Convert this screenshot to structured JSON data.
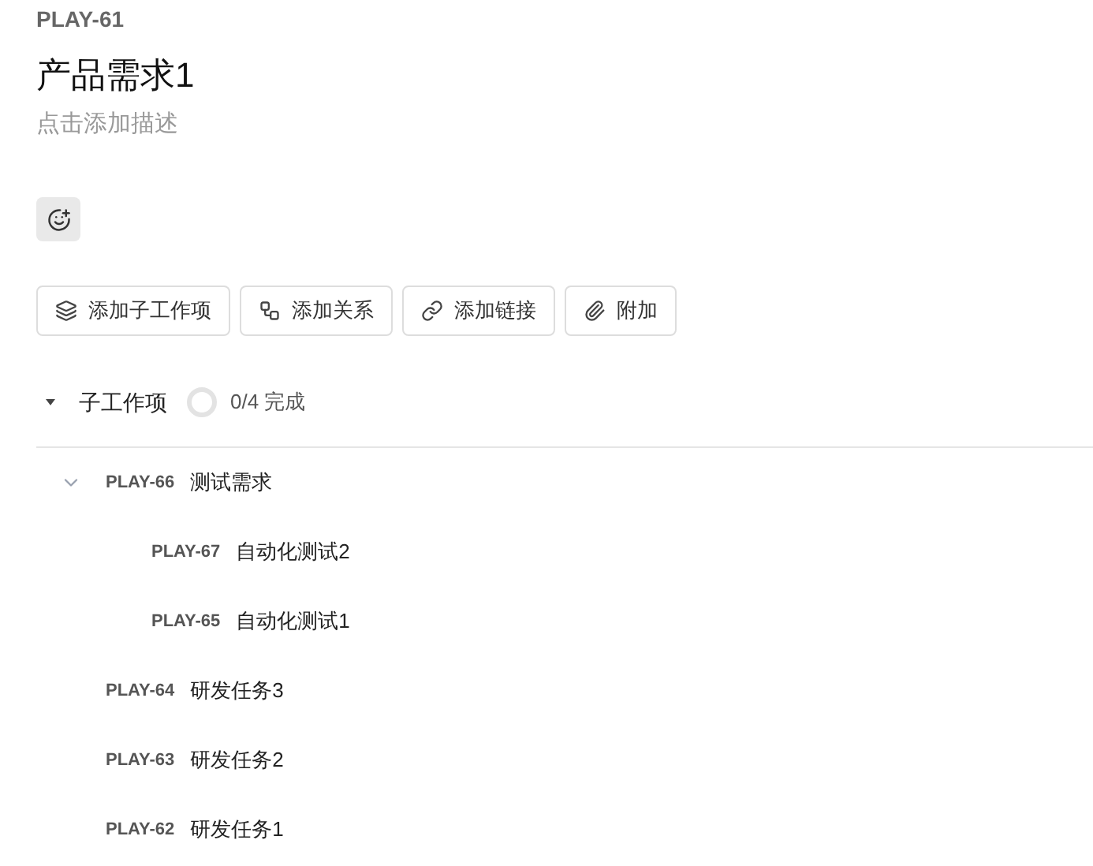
{
  "issue": {
    "key": "PLAY-61",
    "title": "产品需求1",
    "description_placeholder": "点击添加描述"
  },
  "actions": [
    {
      "kind": "layers",
      "label": "添加子工作项"
    },
    {
      "kind": "relation",
      "label": "添加关系"
    },
    {
      "kind": "link",
      "label": "添加链接"
    },
    {
      "kind": "attach",
      "label": "附加"
    }
  ],
  "subitems": {
    "title": "子工作项",
    "expanded": true,
    "progress": "0/4 完成",
    "items": [
      {
        "key": "PLAY-66",
        "title": "测试需求",
        "expanded": true,
        "children": [
          {
            "key": "PLAY-67",
            "title": "自动化测试2"
          },
          {
            "key": "PLAY-65",
            "title": "自动化测试1"
          }
        ]
      },
      {
        "key": "PLAY-64",
        "title": "研发任务3"
      },
      {
        "key": "PLAY-63",
        "title": "研发任务2"
      },
      {
        "key": "PLAY-62",
        "title": "研发任务1"
      }
    ]
  }
}
